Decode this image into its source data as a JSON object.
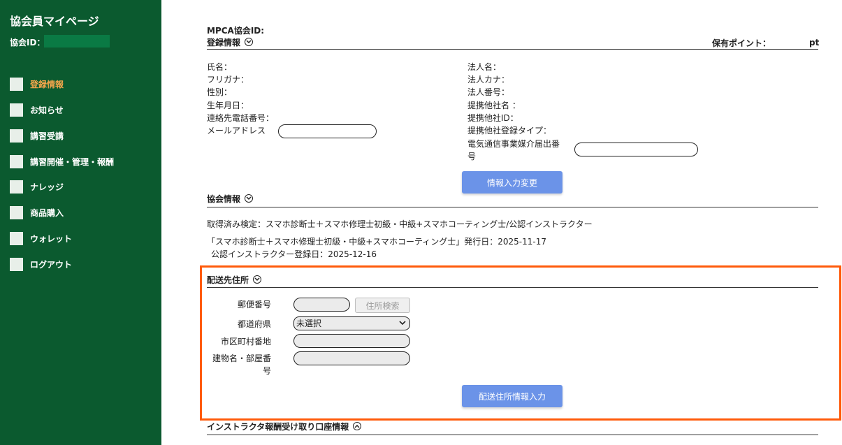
{
  "sidebar": {
    "title": "協会員マイページ",
    "id_label": "協会ID：",
    "items": [
      {
        "label": "登録情報",
        "active": true
      },
      {
        "label": "お知らせ"
      },
      {
        "label": "講習受講"
      },
      {
        "label": "講習開催・管理・報酬"
      },
      {
        "label": "ナレッジ"
      },
      {
        "label": "商品購入"
      },
      {
        "label": "ウォレット"
      },
      {
        "label": "ログアウト"
      }
    ]
  },
  "main": {
    "mpca_id_label": "MPCA協会ID:",
    "reg_section_title": "登録情報",
    "points_label": "保有ポイント：",
    "points_unit": "pt",
    "left_fields": [
      "氏名：",
      "フリガナ：",
      "性別：",
      "生年月日：",
      "連絡先電話番号：",
      "メールアドレス"
    ],
    "right_fields": [
      "法人名：",
      "法人カナ：",
      "法人番号：",
      "提携他社名 ：",
      "提携他社ID：",
      "提携他社登録タイプ："
    ],
    "telecom_label_1": "電気通信事業媒介届出番",
    "telecom_label_2": "号",
    "change_button": "情報入力変更",
    "assoc_section_title": "協会情報",
    "acquired_certs": "取得済み検定：スマホ診断士＋スマホ修理士初級・中級+スマホコーティング士/公認インストラクター",
    "issue_line": "「スマホ診断士＋スマホ修理士初級・中級+スマホコーティング士」発行日：2025-11-17",
    "instructor_line": "公認インストラクター登録日：2025-12-16",
    "shipping": {
      "title": "配送先住所",
      "postal_label": "郵便番号",
      "search_button": "住所検索",
      "pref_label": "都道府県",
      "pref_value": "未選択",
      "city_label": "市区町村番地",
      "building_label_1": "建物名・部屋番",
      "building_label_2": "号",
      "submit_button": "配送住所情報入力"
    },
    "bank_section_title": "インストラクタ報酬受け取り口座情報"
  },
  "colors": {
    "sidebar_bg": "#0b5a2f",
    "active_item": "#f4a64b",
    "button_blue": "#6b93e8",
    "highlight_border": "#ff5a0a"
  }
}
